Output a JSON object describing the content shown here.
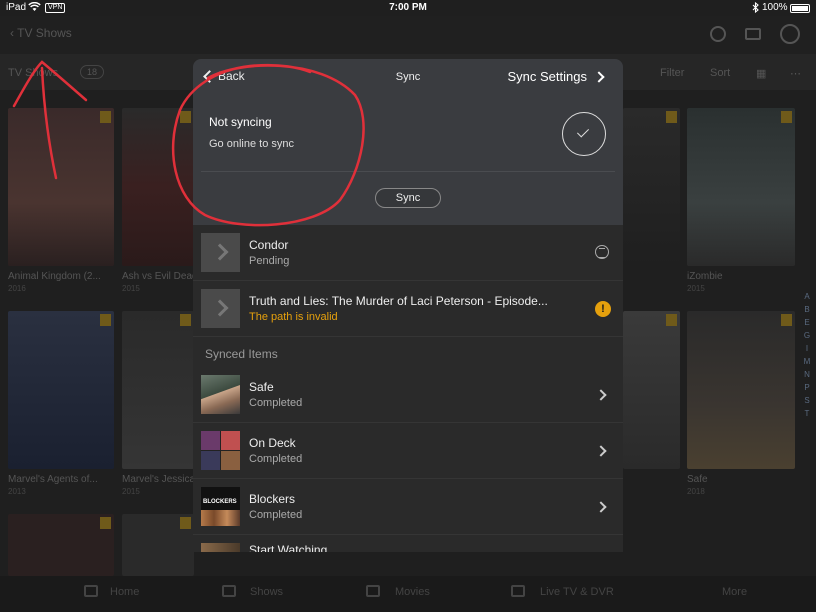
{
  "status_bar": {
    "device": "iPad",
    "vpn": "VPN",
    "time": "7:00 PM",
    "battery": "100%"
  },
  "background": {
    "nav_title": "TV Shows",
    "section_label": "TV Shows",
    "count": "18",
    "filter_label": "Filter",
    "sort_label": "Sort",
    "posters": [
      {
        "caption": "Animal Kingdom (2...",
        "year": "2016"
      },
      {
        "caption": "Ash vs Evil Dead",
        "year": "2015"
      },
      {
        "caption": "iZombie",
        "year": "2015"
      },
      {
        "caption": "Marvel's Agents of...",
        "year": "2013"
      },
      {
        "caption": "Marvel's Jessica...",
        "year": "2015"
      },
      {
        "caption": "Safe",
        "year": "2018"
      }
    ],
    "alphabet": [
      "A",
      "B",
      "E",
      "G",
      "I",
      "M",
      "N",
      "P",
      "S",
      "T"
    ],
    "tabs": [
      "Home",
      "Shows",
      "Movies",
      "Live TV & DVR",
      "More"
    ]
  },
  "modal": {
    "back_label": "Back",
    "title": "Sync",
    "settings_label": "Sync Settings",
    "status": {
      "title": "Not syncing",
      "subtitle": "Go online to sync",
      "sync_button": "Sync"
    },
    "pending_items": [
      {
        "title": "Condor",
        "status": "Pending",
        "state": "pending"
      },
      {
        "title": "Truth and Lies: The Murder of Laci Peterson - Episode...",
        "status": "The path is invalid",
        "state": "error"
      }
    ],
    "synced_header": "Synced Items",
    "synced_items": [
      {
        "title": "Safe",
        "status": "Completed"
      },
      {
        "title": "On Deck",
        "status": "Completed"
      },
      {
        "title": "Blockers",
        "status": "Completed"
      },
      {
        "title": "Start Watching",
        "status": ""
      }
    ],
    "blockers_thumb_text": "BLOCKERS"
  },
  "colors": {
    "accent_warning": "#e5a00d",
    "annotation_red": "#e0303a"
  }
}
